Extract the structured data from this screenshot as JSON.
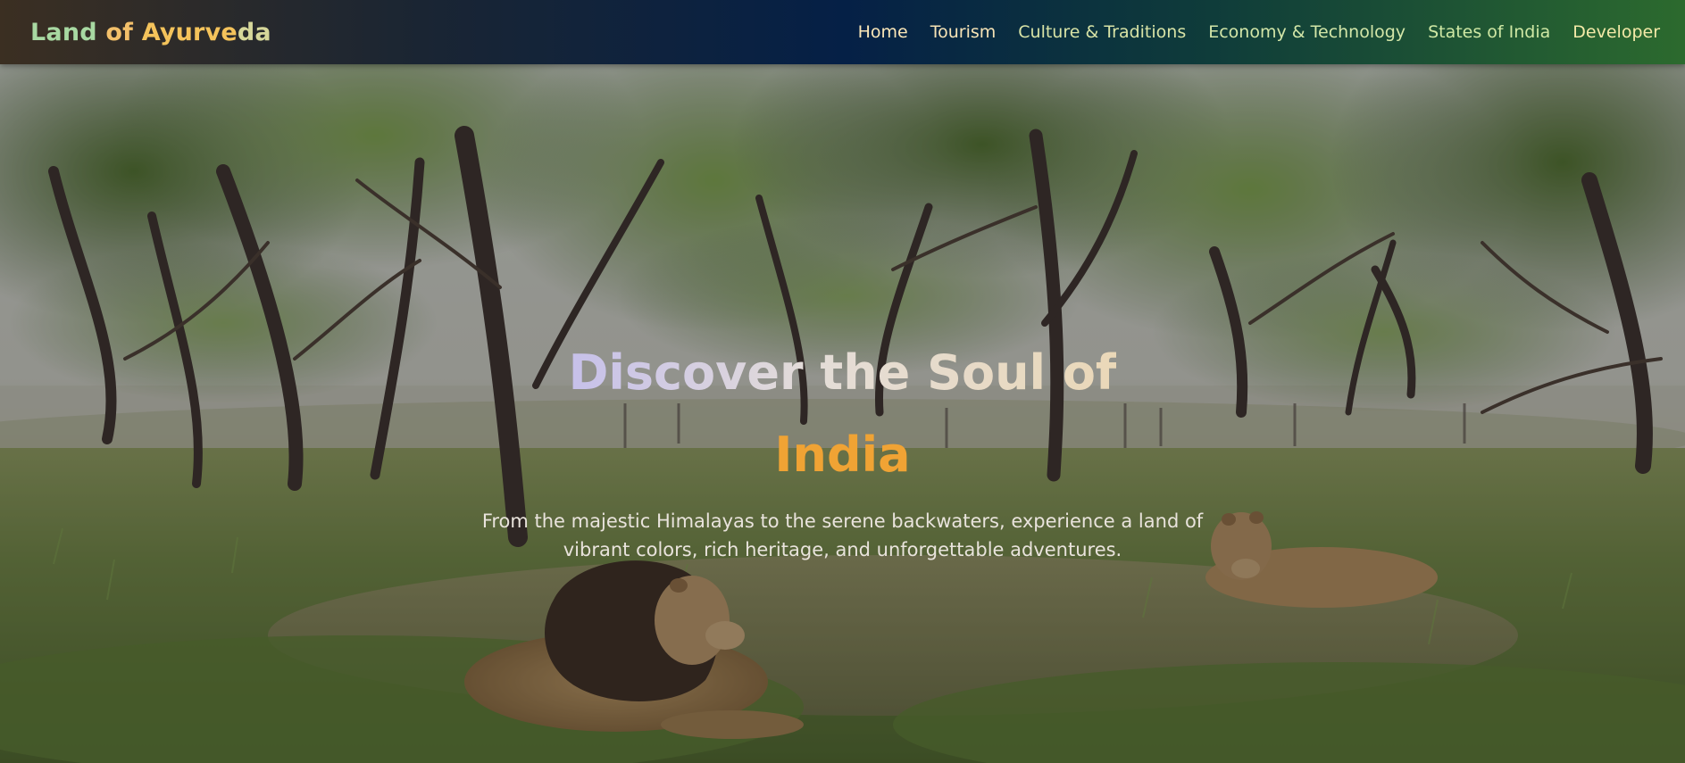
{
  "brand": {
    "part1": "Land",
    "part2": "of",
    "part3": "Ayurve",
    "part4": "da"
  },
  "nav": {
    "items": [
      {
        "label": "Home"
      },
      {
        "label": "Tourism"
      },
      {
        "label": "Culture & Traditions"
      },
      {
        "label": "Economy & Technology"
      },
      {
        "label": "States of India"
      },
      {
        "label": "Developer"
      }
    ]
  },
  "hero": {
    "title_line1": "Discover the Soul of",
    "title_line2": "India",
    "subtitle": "From the majestic Himalayas to the serene backwaters, experience a land of vibrant colors, rich heritage, and unforgettable adventures."
  }
}
